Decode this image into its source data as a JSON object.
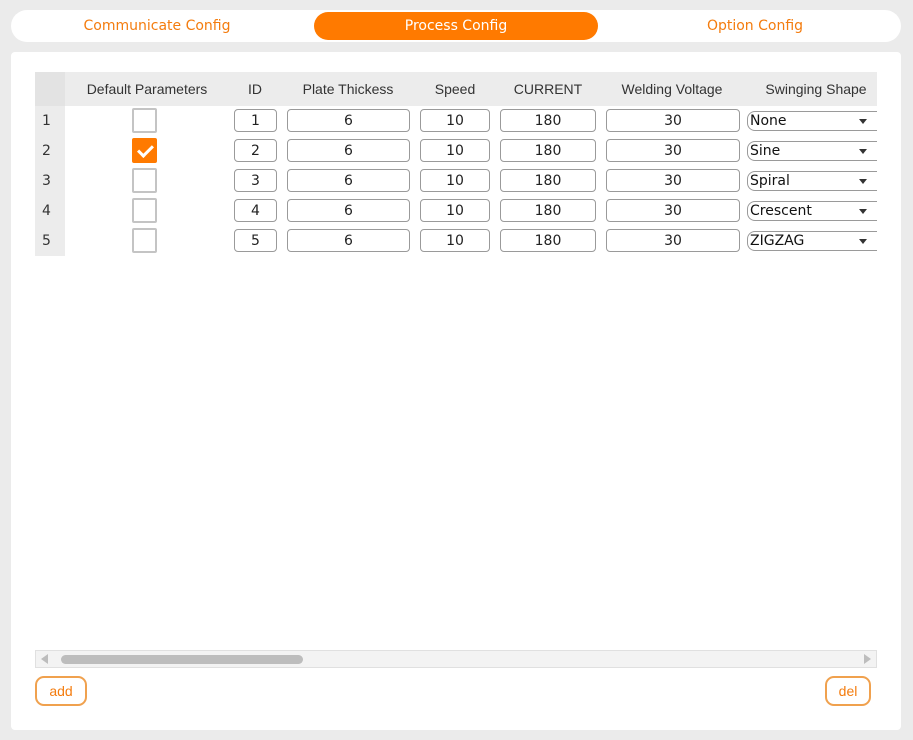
{
  "tabs": [
    {
      "label": "Communicate Config",
      "active": false
    },
    {
      "label": "Process Config",
      "active": true
    },
    {
      "label": "Option Config",
      "active": false
    }
  ],
  "table": {
    "headers": {
      "default": "Default Parameters",
      "id": "ID",
      "plate": "Plate Thickess",
      "speed": "Speed",
      "current": "CURRENT",
      "voltage": "Welding Voltage",
      "shape": "Swinging Shape"
    },
    "rows": [
      {
        "num": "1",
        "checked": false,
        "id": "1",
        "plate": "6",
        "speed": "10",
        "current": "180",
        "voltage": "30",
        "shape": "None"
      },
      {
        "num": "2",
        "checked": true,
        "id": "2",
        "plate": "6",
        "speed": "10",
        "current": "180",
        "voltage": "30",
        "shape": "Sine"
      },
      {
        "num": "3",
        "checked": false,
        "id": "3",
        "plate": "6",
        "speed": "10",
        "current": "180",
        "voltage": "30",
        "shape": "Spiral"
      },
      {
        "num": "4",
        "checked": false,
        "id": "4",
        "plate": "6",
        "speed": "10",
        "current": "180",
        "voltage": "30",
        "shape": "Crescent"
      },
      {
        "num": "5",
        "checked": false,
        "id": "5",
        "plate": "6",
        "speed": "10",
        "current": "180",
        "voltage": "30",
        "shape": "ZIGZAG"
      }
    ]
  },
  "buttons": {
    "add": "add",
    "del": "del"
  },
  "colors": {
    "accent": "#ff7a00"
  }
}
